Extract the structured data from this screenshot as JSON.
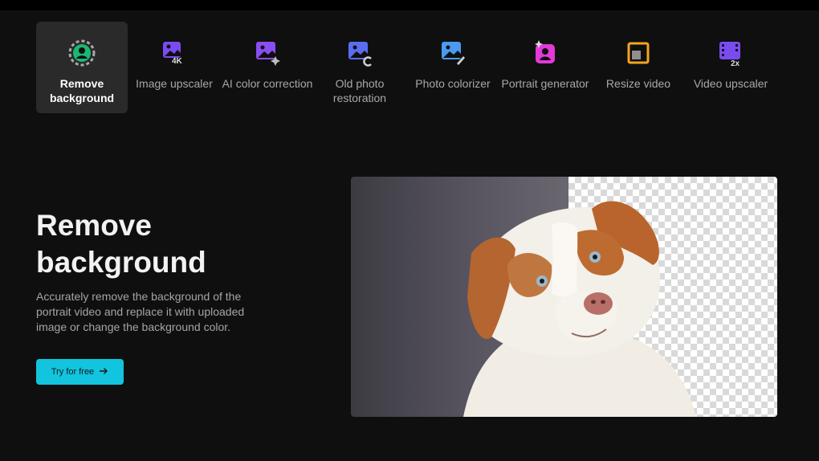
{
  "tools": [
    {
      "label": "Remove background",
      "icon": "person-remove-bg-icon",
      "active": true
    },
    {
      "label": "Image upscaler",
      "icon": "image-4k-icon",
      "badge": "4K"
    },
    {
      "label": "AI color correction",
      "icon": "image-sparkle-icon"
    },
    {
      "label": "Old photo restoration",
      "icon": "image-restore-icon"
    },
    {
      "label": "Photo colorizer",
      "icon": "image-brush-icon"
    },
    {
      "label": "Portrait generator",
      "icon": "portrait-sparkle-icon"
    },
    {
      "label": "Resize video",
      "icon": "resize-square-icon"
    },
    {
      "label": "Video upscaler",
      "icon": "film-2x-icon",
      "badge": "2x"
    }
  ],
  "hero": {
    "title": "Remove background",
    "description": "Accurately remove the background of the portrait video and replace it with uploaded image or change the background color.",
    "cta_label": "Try for free",
    "cta_icon": "arrow-right-icon"
  },
  "colors": {
    "background": "#0f0f0f",
    "accent": "#12c4dd",
    "active_tile": "#2a2a2a",
    "icon_green": "#19b974",
    "icon_purple": "#7a4cf0",
    "icon_blue": "#4a9af0",
    "icon_magenta": "#e13bd7",
    "icon_orange": "#f4a51c"
  }
}
